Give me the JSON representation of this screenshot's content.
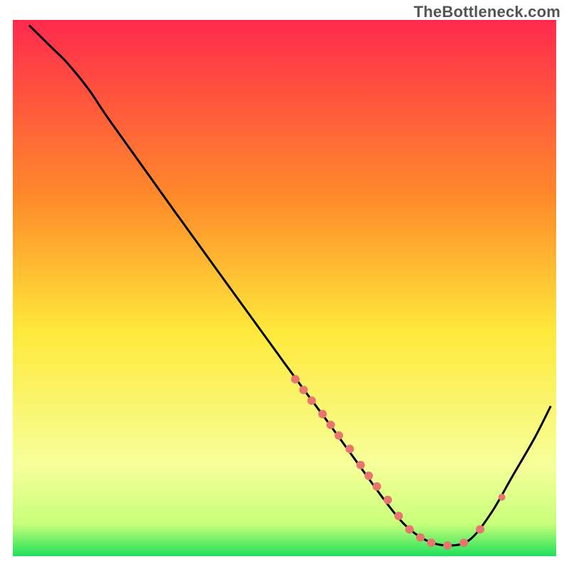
{
  "watermark": "TheBottleneck.com",
  "chart_data": {
    "type": "line",
    "title": "",
    "xlabel": "",
    "ylabel": "",
    "xlim": [
      0,
      100
    ],
    "ylim": [
      0,
      100
    ],
    "gradient_stops": [
      {
        "offset": 0,
        "color": "#ff2a4d"
      },
      {
        "offset": 33,
        "color": "#ff8a2a"
      },
      {
        "offset": 58,
        "color": "#ffe93a"
      },
      {
        "offset": 83,
        "color": "#f6ff9a"
      },
      {
        "offset": 94,
        "color": "#c8ff7a"
      },
      {
        "offset": 100,
        "color": "#1fe05a"
      }
    ],
    "series": [
      {
        "name": "bottleneck-curve",
        "color": "#000000",
        "points": [
          {
            "x": 3,
            "y": 99
          },
          {
            "x": 7,
            "y": 95
          },
          {
            "x": 10,
            "y": 92
          },
          {
            "x": 14,
            "y": 87
          },
          {
            "x": 18,
            "y": 81
          },
          {
            "x": 30,
            "y": 64
          },
          {
            "x": 50,
            "y": 36
          },
          {
            "x": 58,
            "y": 25
          },
          {
            "x": 63,
            "y": 18
          },
          {
            "x": 68,
            "y": 11
          },
          {
            "x": 72,
            "y": 6
          },
          {
            "x": 76,
            "y": 3
          },
          {
            "x": 80,
            "y": 2
          },
          {
            "x": 84,
            "y": 3
          },
          {
            "x": 88,
            "y": 8
          },
          {
            "x": 92,
            "y": 15
          },
          {
            "x": 96,
            "y": 22
          },
          {
            "x": 99,
            "y": 28
          }
        ]
      }
    ],
    "markers": {
      "color": "#e8766e",
      "points": [
        {
          "x": 52,
          "y": 33,
          "r": 6
        },
        {
          "x": 53.5,
          "y": 31,
          "r": 6
        },
        {
          "x": 55,
          "y": 29,
          "r": 6
        },
        {
          "x": 57,
          "y": 26.5,
          "r": 6
        },
        {
          "x": 58.5,
          "y": 24.5,
          "r": 6
        },
        {
          "x": 60,
          "y": 22.5,
          "r": 6
        },
        {
          "x": 62,
          "y": 20,
          "r": 6
        },
        {
          "x": 64,
          "y": 17,
          "r": 6
        },
        {
          "x": 65.5,
          "y": 15,
          "r": 6
        },
        {
          "x": 67,
          "y": 13,
          "r": 6
        },
        {
          "x": 69,
          "y": 10.5,
          "r": 6
        },
        {
          "x": 71,
          "y": 7.5,
          "r": 6
        },
        {
          "x": 73,
          "y": 5,
          "r": 6
        },
        {
          "x": 75,
          "y": 3.5,
          "r": 6
        },
        {
          "x": 77,
          "y": 2.5,
          "r": 6
        },
        {
          "x": 80,
          "y": 2,
          "r": 6
        },
        {
          "x": 83,
          "y": 2.5,
          "r": 6
        },
        {
          "x": 86,
          "y": 5,
          "r": 6
        },
        {
          "x": 90,
          "y": 11,
          "r": 5
        }
      ]
    }
  }
}
